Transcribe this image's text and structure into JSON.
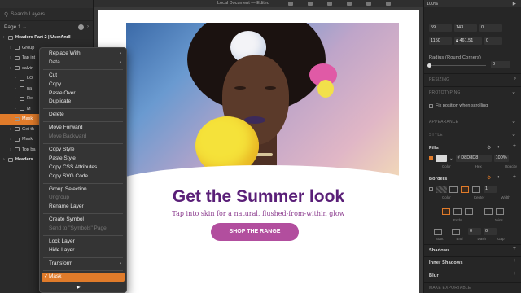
{
  "left_panel": {
    "search_placeholder": "Search Layers",
    "page_label": "Page 1",
    "layers": [
      {
        "label": "Headers Part 2 | UserAndI",
        "kind": "hdr"
      },
      {
        "label": "Group",
        "kind": "item"
      },
      {
        "label": "Tap int",
        "kind": "item"
      },
      {
        "label": "calvin",
        "kind": "item"
      },
      {
        "label": "LO",
        "kind": "item"
      },
      {
        "label": "na",
        "kind": "item"
      },
      {
        "label": "Re",
        "kind": "item"
      },
      {
        "label": "M",
        "kind": "item"
      },
      {
        "label": "Mask",
        "kind": "sel"
      },
      {
        "label": "Get th",
        "kind": "item"
      },
      {
        "label": "Mask",
        "kind": "item"
      },
      {
        "label": "Top ba",
        "kind": "item"
      },
      {
        "label": "Headers",
        "kind": "hdr"
      }
    ]
  },
  "context_menu": {
    "items": [
      {
        "label": "Replace With",
        "submenu": true
      },
      {
        "label": "Data",
        "submenu": true
      },
      {
        "sep": true
      },
      {
        "label": "Cut"
      },
      {
        "label": "Copy"
      },
      {
        "label": "Paste Over"
      },
      {
        "label": "Duplicate"
      },
      {
        "sep": true
      },
      {
        "label": "Delete"
      },
      {
        "sep": true
      },
      {
        "label": "Move Forward"
      },
      {
        "label": "Move Backward",
        "disabled": true
      },
      {
        "sep": true
      },
      {
        "label": "Copy Style"
      },
      {
        "label": "Paste Style"
      },
      {
        "label": "Copy CSS Attributes"
      },
      {
        "label": "Copy SVG Code"
      },
      {
        "sep": true
      },
      {
        "label": "Group Selection"
      },
      {
        "label": "Ungroup",
        "disabled": true
      },
      {
        "label": "Rename Layer"
      },
      {
        "sep": true
      },
      {
        "label": "Create Symbol"
      },
      {
        "label": "Send to \"Symbols\" Page",
        "disabled": true
      },
      {
        "sep": true
      },
      {
        "label": "Lock Layer"
      },
      {
        "label": "Hide Layer"
      },
      {
        "sep": true
      },
      {
        "label": "Transform",
        "submenu": true
      },
      {
        "sep": true
      },
      {
        "label": "Mask",
        "checked": true,
        "highlight": true
      }
    ]
  },
  "toolbar": {
    "doc_title": "Local Document — Edited"
  },
  "artboard": {
    "headline": "Get the Summer look",
    "subline": "Tap into skin for a natural, flushed-from-within glow",
    "cta_label": "SHOP THE RANGE"
  },
  "inspector": {
    "zoom": "100%",
    "pos_x": "59",
    "pos_y": "143",
    "rot": "0",
    "width": "1150",
    "height": "461.51",
    "radius_label": "Radius (Round Corners)",
    "radius_value": "0",
    "resizing": "RESIZING",
    "prototyping": "PROTOTYPING",
    "fix_position": "Fix position when scrolling",
    "appearance": "APPEARANCE",
    "style": "STYLE",
    "fills": "Fills",
    "fill_hex": "D8D8D8",
    "fill_opacity": "100%",
    "fill_lbl_color": "Color",
    "fill_lbl_hex": "Hex",
    "fill_lbl_opacity": "Opacity",
    "borders": "Borders",
    "border_value": "1",
    "border_lbl_color": "Color",
    "border_lbl_center": "Center",
    "border_lbl_width": "Width",
    "ends_lbl": "Ends",
    "joins_lbl": "Joins",
    "start_lbl": "Start",
    "end_lbl": "End",
    "dash_lbl": "Dash",
    "gap_lbl": "Gap",
    "dash_start": "0",
    "dash_end": "0",
    "shadows": "Shadows",
    "inner_shadows": "Inner Shadows",
    "blur": "Blur",
    "make_exportable": "MAKE EXPORTABLE"
  },
  "colors": {
    "accent": "#e07b2a",
    "headline": "#5a1f78",
    "cta": "#b24e9e"
  }
}
